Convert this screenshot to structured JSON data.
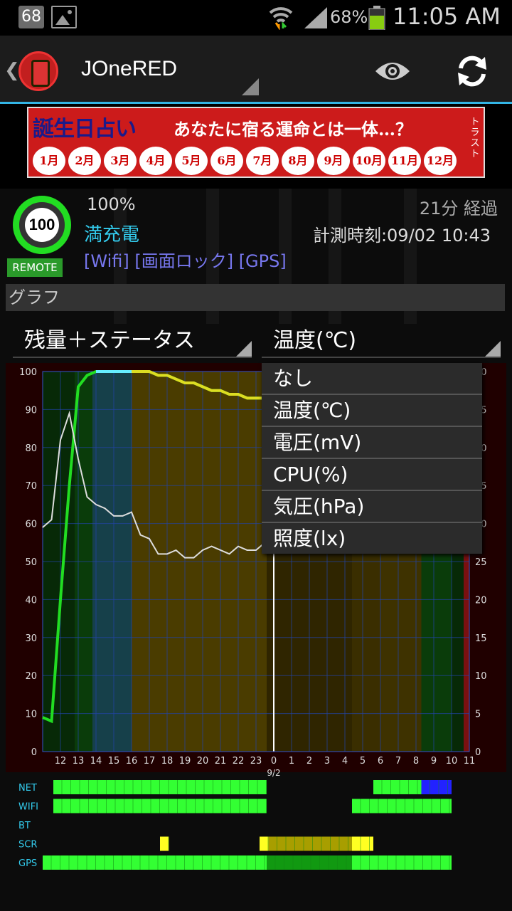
{
  "status_bar": {
    "notification_badge": "68",
    "battery_percent": "68%",
    "time": "11:05 AM",
    "icons": [
      "image-icon",
      "wifi-icon",
      "signal-icon",
      "battery-icon"
    ]
  },
  "action_bar": {
    "title": "JOneRED",
    "icons": [
      "back-chevron-icon",
      "app-logo-icon",
      "eye-icon",
      "refresh-icon"
    ]
  },
  "ad": {
    "title": "誕生日占い",
    "subtitle": "あなたに宿る運命とは一体…？",
    "side_text": "トラスト",
    "months": [
      "1月",
      "2月",
      "3月",
      "4月",
      "5月",
      "6月",
      "7月",
      "8月",
      "9月",
      "10月",
      "11月",
      "12月"
    ]
  },
  "battery": {
    "level": "100",
    "remote_label": "REMOTE",
    "percent_text": "100%",
    "charge_status": "満充電",
    "flags": "[Wifi] [画面ロック] [GPS]",
    "elapsed": "21分 経過",
    "measured_at": "計測時刻:09/02 10:43"
  },
  "graph": {
    "section_label": "グラフ",
    "left_spinner": "残量＋ステータス",
    "right_spinner": "温度(℃)"
  },
  "dropdown": {
    "items": [
      "なし",
      "温度(℃)",
      "電圧(mV)",
      "CPU(%)",
      "気圧(hPa)",
      "照度(lx)"
    ]
  },
  "chart_data": {
    "type": "line",
    "x_ticks": [
      "12",
      "13",
      "14",
      "15",
      "16",
      "17",
      "18",
      "19",
      "20",
      "21",
      "22",
      "23",
      "0",
      "1",
      "2",
      "3",
      "4",
      "5",
      "6",
      "7",
      "8",
      "9",
      "10",
      "11"
    ],
    "date_marker": "9/2",
    "ylim_left": [
      0,
      100
    ],
    "y_ticks_left": [
      0,
      10,
      20,
      30,
      40,
      50,
      60,
      70,
      80,
      90,
      100
    ],
    "y_ticks_right": [
      "0",
      "5",
      "10",
      "15",
      "20",
      "25",
      "30",
      "35",
      "40",
      "45",
      "50"
    ],
    "series": [
      {
        "color": "#22dd22",
        "x": [
          11.0,
          11.5,
          12.0,
          12.5,
          13.0,
          13.5,
          14.0,
          14.5,
          15.0,
          15.5,
          16.0,
          16.5,
          17.0,
          17.5,
          18.0,
          18.5,
          19.0,
          19.5,
          20.0,
          20.5,
          21.0,
          21.5,
          22.0,
          22.5,
          23.0,
          23.5,
          24.0
        ],
        "values": [
          9,
          8,
          40,
          70,
          96,
          99,
          100,
          100,
          100,
          100,
          100,
          100,
          100,
          99,
          99,
          98,
          97,
          97,
          96,
          95,
          95,
          94,
          94,
          93,
          93,
          93,
          97
        ]
      },
      {
        "color": "#dddddd",
        "x": [
          11.0,
          11.5,
          12.0,
          12.5,
          13.0,
          13.5,
          14.0,
          14.5,
          15.0,
          15.5,
          16.0,
          16.5,
          17.0,
          17.5,
          18.0,
          18.5,
          19.0,
          19.5,
          20.0,
          20.5,
          21.0,
          21.5,
          22.0,
          22.5,
          23.0,
          23.5,
          24.0
        ],
        "values": [
          59,
          61,
          82,
          89,
          77,
          67,
          65,
          64,
          62,
          62,
          63,
          57,
          56,
          52,
          52,
          53,
          51,
          51,
          53,
          54,
          53,
          52,
          54,
          53,
          53,
          55,
          58
        ]
      }
    ],
    "status_rows": [
      {
        "label": "NET",
        "segments": [
          [
            11.6,
            23.6,
            "#33ff33"
          ],
          [
            5.6,
            8.3,
            "#33ff33"
          ],
          [
            8.3,
            10.0,
            "#2222ff"
          ]
        ]
      },
      {
        "label": "WIFI",
        "segments": [
          [
            11.6,
            23.6,
            "#33ff33"
          ],
          [
            4.4,
            10.0,
            "#33ff33"
          ]
        ]
      },
      {
        "label": "BT",
        "segments": []
      },
      {
        "label": "SCR",
        "segments": [
          [
            17.6,
            18.1,
            "#ffff22"
          ],
          [
            23.2,
            23.7,
            "#ffff22"
          ],
          [
            23.7,
            4.4,
            "#a89e00"
          ],
          [
            4.4,
            5.6,
            "#ffff22"
          ]
        ]
      },
      {
        "label": "GPS",
        "segments": [
          [
            11.0,
            23.6,
            "#33ff33"
          ],
          [
            23.6,
            4.4,
            "#119911"
          ],
          [
            4.4,
            10.0,
            "#33ff33"
          ]
        ]
      }
    ]
  }
}
